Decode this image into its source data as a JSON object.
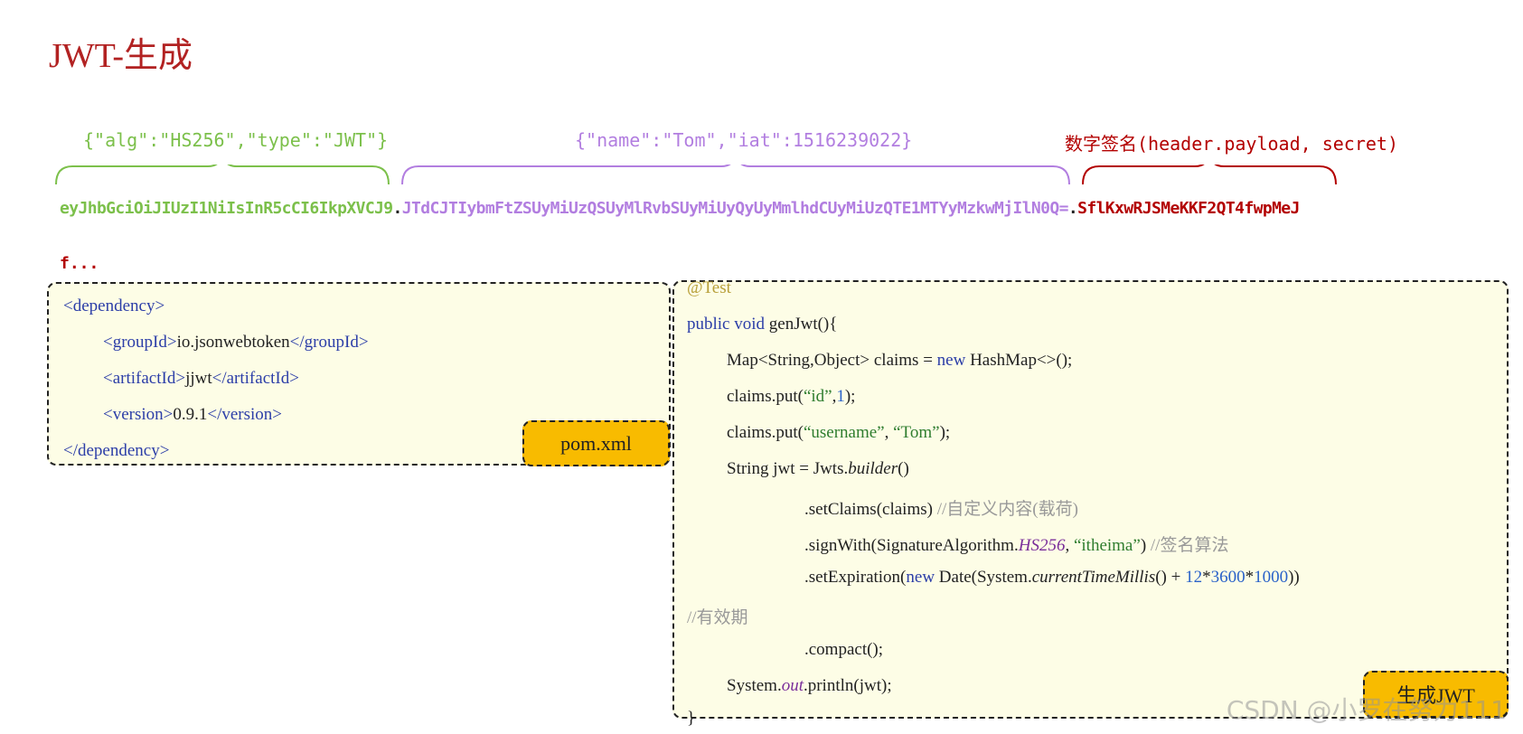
{
  "title": "JWT-生成",
  "labels": {
    "header": "{\"alg\":\"HS256\",\"type\":\"JWT\"}",
    "payload": "{\"name\":\"Tom\",\"iat\":1516239022}",
    "signature": "数字签名(header.payload, secret)"
  },
  "token": {
    "header": "eyJhbGciOiJIUzI1NiIsInR5cCI6IkpXVCJ9",
    "sep1": ".",
    "payload": "JTdCJTIybmFtZSUyMiUzQSUyMlRvbSUyMiUyQyUyMmlhdCUyMiUzQTE1MTYyMzkwMjIlN0Q=",
    "sep2": ".",
    "signature": "SflKxwRJSMeKKF2QT4fwpMeJ",
    "continuation": "f..."
  },
  "colors": {
    "title": "#b22222",
    "header": "#7cc04b",
    "payload": "#b27ee0",
    "signature": "#b30000",
    "box_bg": "#fdfde6",
    "badge_bg": "#f8bb00"
  },
  "pom": {
    "dependency_open": "<dependency>",
    "groupId_open": "<groupId>",
    "groupId": "io.jsonwebtoken",
    "groupId_close": "</groupId>",
    "artifactId_open": "<artifactId>",
    "artifactId": "jjwt",
    "artifactId_close": "</artifactId>",
    "version_open": "<version>",
    "version": "0.9.1",
    "version_close": "</version>",
    "dependency_close": "</dependency>",
    "badge": "pom.xml"
  },
  "code": {
    "annotation": "@Test",
    "l1_a": "public void ",
    "l1_b": "genJwt(){",
    "l2_a": "Map<String,Object> claims = ",
    "l2_b": "new ",
    "l2_c": "HashMap<>();",
    "l3_a": "claims.put(",
    "l3_b": "“id”",
    "l3_c": ",",
    "l3_d": "1",
    "l3_e": ");",
    "l4_a": "claims.put(",
    "l4_b": "“username”",
    "l4_c": ", ",
    "l4_d": "“Tom”",
    "l4_e": ");",
    "l5_a": "String jwt = Jwts.",
    "l5_b": "builder",
    "l5_c": "()",
    "l6_a": ".setClaims(claims) ",
    "l6_b": "//自定义内容(载荷)",
    "l7_a": ".signWith(SignatureAlgorithm.",
    "l7_b": "HS256",
    "l7_c": ", ",
    "l7_d": "“itheima”",
    "l7_e": ") ",
    "l7_f": "//签名算法",
    "l8_a": ".setExpiration(",
    "l8_b": "new ",
    "l8_c": "Date(System.",
    "l8_d": "currentTimeMillis",
    "l8_e": "() + ",
    "l8_f": "12",
    "l8_g": "*",
    "l8_h": "3600",
    "l8_i": "*",
    "l8_j": "1000",
    "l8_k": "))",
    "l9": "//有效期",
    "l10": ".compact();",
    "l11_a": "System.",
    "l11_b": "out",
    "l11_c": ".println(jwt);",
    "l12": "}",
    "badge": "生成JWT"
  },
  "watermark": "CSDN @小罗在努力111"
}
